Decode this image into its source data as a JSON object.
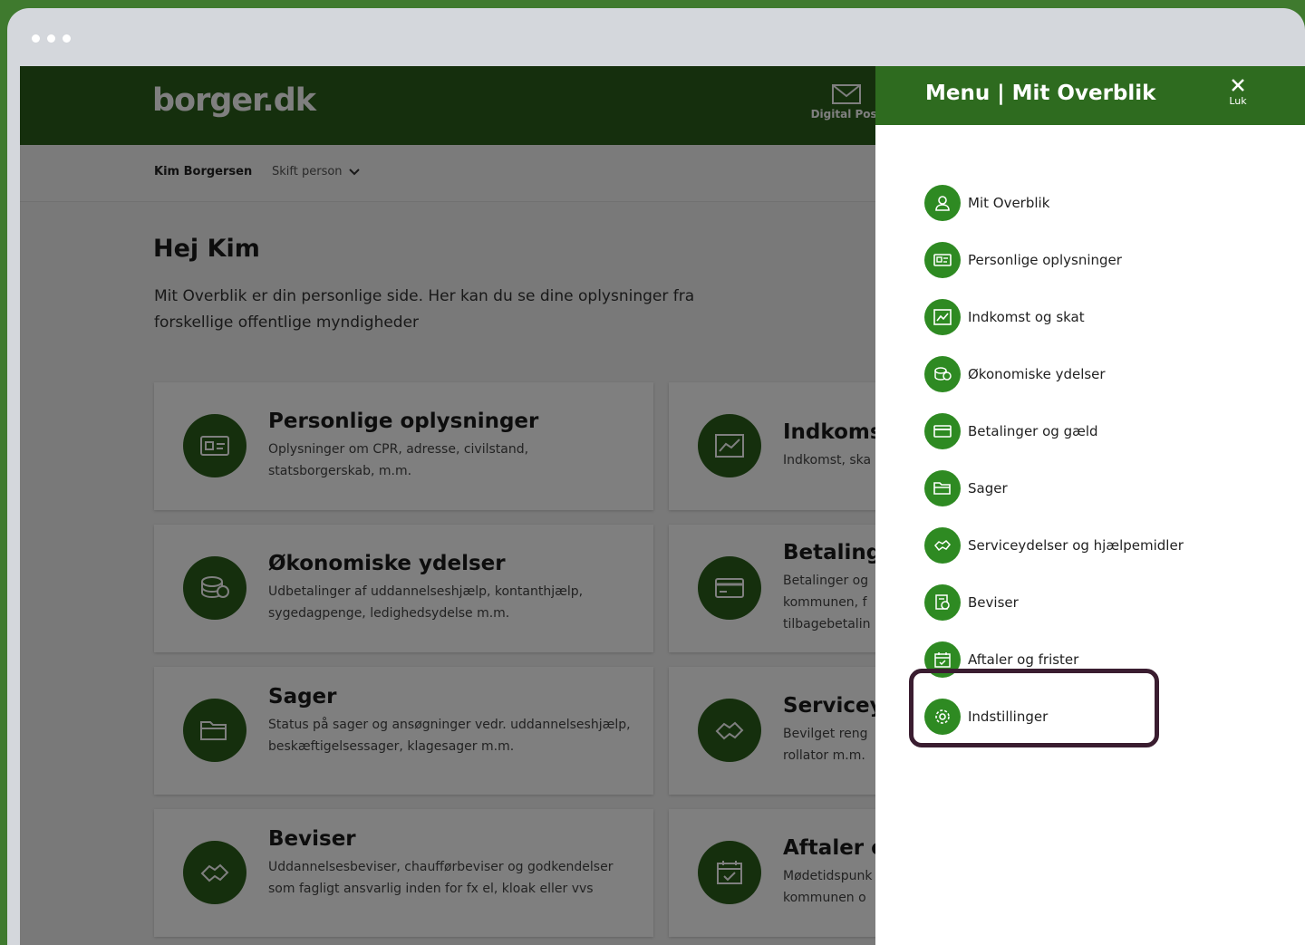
{
  "app": {
    "logo": "borger.dk",
    "digital_post_label": "Digital Post"
  },
  "user": {
    "name": "Kim Borgersen",
    "switch_label": "Skift person"
  },
  "page": {
    "greeting": "Hej Kim",
    "intro": "Mit Overblik er din personlige side. Her kan du se dine oplysninger fra forskellige offentlige myndigheder"
  },
  "cards": [
    {
      "title": "Personlige oplysninger",
      "desc": "Oplysninger om CPR, adresse, civilstand, statsborgerskab, m.m.",
      "icon": "id-card-icon"
    },
    {
      "title": "Indkoms",
      "desc": "Indkomst, ska",
      "icon": "chart-icon"
    },
    {
      "title": "Økonomiske ydelser",
      "desc": "Udbetalinger af uddannelseshjælp, kontanthjælp, sygedagpenge, ledighedsydelse m.m.",
      "icon": "coins-icon"
    },
    {
      "title": "Betaling",
      "desc": "Betalinger og kommunen, f tilbagebetalin",
      "icon": "card-icon"
    },
    {
      "title": "Sager",
      "desc": "Status på sager og ansøgninger vedr. uddannelseshjælp, beskæftigelsessager, klagesager m.m.",
      "icon": "folder-icon"
    },
    {
      "title": "Servicey",
      "desc": "Bevilget reng rollator m.m.",
      "icon": "handshake-icon"
    },
    {
      "title": "Beviser",
      "desc": "Uddannelsesbeviser, chaufførbeviser og godkendelser som fagligt ansvarlig inden for fx el, kloak eller vvs",
      "icon": "handshake-icon"
    },
    {
      "title": "Aftaler o",
      "desc": "Mødetidspunk kommunen o",
      "icon": "calendar-icon"
    }
  ],
  "menu": {
    "title": "Menu | Mit Overblik",
    "close_label": "Luk",
    "items": [
      {
        "label": "Mit Overblik",
        "icon": "person-icon"
      },
      {
        "label": "Personlige oplysninger",
        "icon": "id-card-icon"
      },
      {
        "label": "Indkomst og skat",
        "icon": "chart-icon"
      },
      {
        "label": "Økonomiske ydelser",
        "icon": "coins-icon"
      },
      {
        "label": "Betalinger og gæld",
        "icon": "card-icon"
      },
      {
        "label": "Sager",
        "icon": "folder-icon"
      },
      {
        "label": "Serviceydelser og hjælpemidler",
        "icon": "handshake-icon"
      },
      {
        "label": "Beviser",
        "icon": "certificate-icon"
      },
      {
        "label": "Aftaler og frister",
        "icon": "calendar-icon"
      },
      {
        "label": "Indstillinger",
        "icon": "gear-icon"
      }
    ]
  },
  "colors": {
    "brand_green": "#2a5f1a",
    "menu_icon_green": "#2e8a22",
    "highlight": "#3a1d30",
    "frame": "#3f7a2e"
  }
}
